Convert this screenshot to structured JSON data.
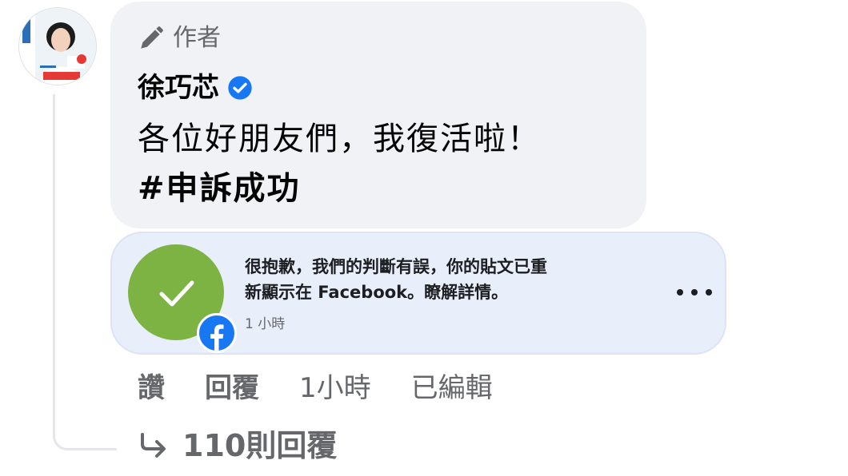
{
  "comment": {
    "author_badge": "作者",
    "author_name": "徐巧芯",
    "text": "各位好朋友們，我復活啦！",
    "hashtag": "#申訴成功"
  },
  "notice": {
    "line1": "很抱歉，我們的判斷有誤，你的貼文已重",
    "line2": "新顯示在 Facebook。瞭解詳情。",
    "time": "1 小時"
  },
  "actions": {
    "like": "讚",
    "reply": "回覆",
    "time": "1小時",
    "edited": "已編輯"
  },
  "replies": {
    "label": "110則回覆"
  },
  "icons": {
    "pencil": "pencil-icon",
    "verified": "verified-badge-icon",
    "check": "checkmark-icon",
    "facebook": "facebook-logo-icon",
    "more": "more-options-icon",
    "reply_arrow": "reply-arrow-icon"
  },
  "colors": {
    "bubble": "#f0f2f5",
    "notice_bg": "#e9eefb",
    "check_green": "#7cb342",
    "facebook_blue": "#1877f2",
    "verified_blue": "#1877f2",
    "secondary_text": "#65676b"
  }
}
